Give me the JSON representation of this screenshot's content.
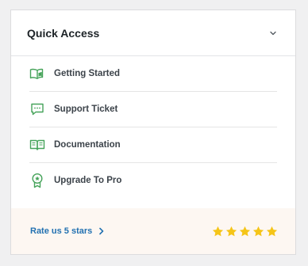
{
  "card": {
    "title": "Quick Access",
    "collapse_icon": "chevron-down-icon"
  },
  "items": [
    {
      "label": "Getting Started",
      "icon": "book-open-icon"
    },
    {
      "label": "Support Ticket",
      "icon": "chat-bubble-icon"
    },
    {
      "label": "Documentation",
      "icon": "book-icon"
    },
    {
      "label": "Upgrade To Pro",
      "icon": "award-badge-icon"
    }
  ],
  "footer": {
    "rate_label": "Rate us 5 stars",
    "rating": 5,
    "max_rating": 5
  },
  "colors": {
    "accent_green": "#46a35a",
    "link_blue": "#2271b1",
    "star_gold": "#f5c518",
    "footer_bg": "#fdf7f2"
  }
}
